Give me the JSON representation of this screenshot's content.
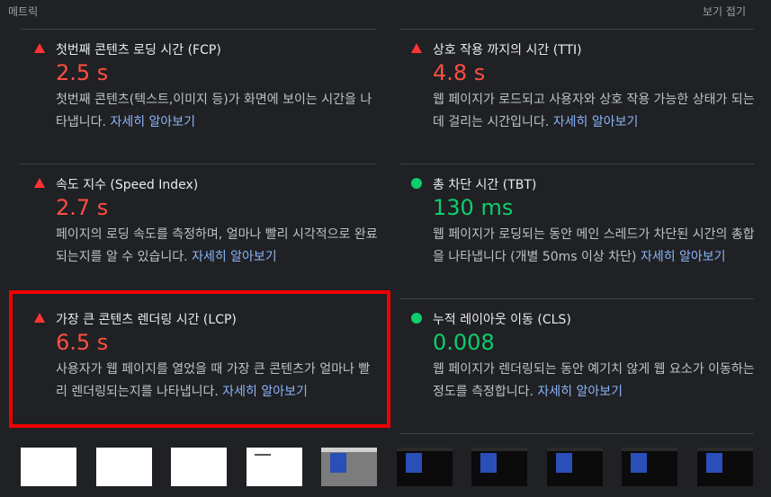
{
  "header": {
    "title": "메트릭",
    "collapse_label": "보기 접기"
  },
  "metrics": [
    {
      "label": "첫번째 콘텐츠 로딩 시간 (FCP)",
      "value": "2.5 s",
      "status": "fail",
      "desc": "첫번째 콘텐츠(텍스트,이미지 등)가 화면에 보이는 시간을 나타냅니다.",
      "link": "자세히 알아보기"
    },
    {
      "label": "상호 작용 까지의 시간 (TTI)",
      "value": "4.8 s",
      "status": "fail",
      "desc": "웹 페이지가 로드되고 사용자와 상호 작용 가능한 상태가 되는데 걸리는 시간입니다.",
      "link": "자세히 알아보기"
    },
    {
      "label": "속도 지수 (Speed Index)",
      "value": "2.7 s",
      "status": "fail",
      "desc": "페이지의 로딩 속도를 측정하며, 얼마나 빨리 시각적으로 완료되는지를 알 수 있습니다.",
      "link": "자세히 알아보기"
    },
    {
      "label": "총 차단 시간 (TBT)",
      "value": "130 ms",
      "status": "pass",
      "desc": "웹 페이지가 로딩되는 동안 메인 스레드가 차단된 시간의 총합을 나타냅니다 (개별 50ms 이상 차단)",
      "link": "자세히 알아보기"
    },
    {
      "label": "가장 큰 콘텐츠 렌더링 시간 (LCP)",
      "value": "6.5 s",
      "status": "fail",
      "desc": "사용자가 웹 페이지를 열었을 때 가장 큰 콘텐츠가 얼마나 빨리 렌더링되는지를 나타냅니다.",
      "link": "자세히 알아보기"
    },
    {
      "label": "누적 레이아웃 이동 (CLS)",
      "value": "0.008",
      "status": "pass",
      "desc": "웹 페이지가 렌더링되는 동안 예기치 않게 웹 요소가 이동하는 정도를 측정합니다.",
      "link": "자세히 알아보기"
    }
  ],
  "colors": {
    "fail": "#ff4e42",
    "pass": "#0cce6b",
    "highlight": "#ee0000"
  }
}
